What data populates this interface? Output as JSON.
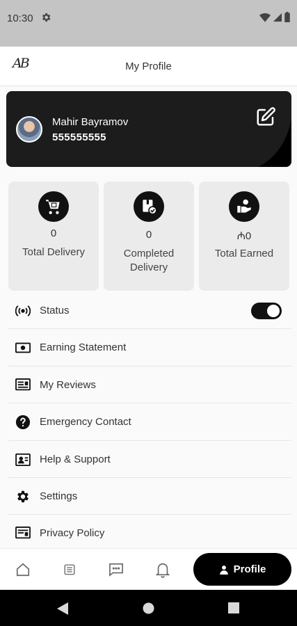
{
  "status_bar": {
    "time": "10:30",
    "icons": [
      "gear-icon",
      "wifi-icon",
      "signal-icon",
      "battery-icon"
    ]
  },
  "app_bar": {
    "logo": "AB",
    "title": "My Profile"
  },
  "profile": {
    "name": "Mahir Bayramov",
    "phone": "555555555",
    "edit_icon": "edit-icon"
  },
  "stats": [
    {
      "icon": "cart-icon",
      "value": "0",
      "label": "Total Delivery"
    },
    {
      "icon": "package-check-icon",
      "value": "0",
      "label": "Completed Delivery"
    },
    {
      "icon": "money-hand-icon",
      "value": "₼0",
      "label": "Total Earned"
    }
  ],
  "menu": [
    {
      "icon": "broadcast-icon",
      "label": "Status",
      "toggle": true
    },
    {
      "icon": "money-icon",
      "label": "Earning Statement"
    },
    {
      "icon": "reviews-icon",
      "label": "My Reviews"
    },
    {
      "icon": "help-circle-icon",
      "label": "Emergency Contact"
    },
    {
      "icon": "contact-card-icon",
      "label": "Help & Support"
    },
    {
      "icon": "settings-icon",
      "label": "Settings"
    },
    {
      "icon": "policy-icon",
      "label": "Privacy Policy"
    }
  ],
  "bottom_nav": {
    "items": [
      "home-icon",
      "list-icon",
      "chat-icon",
      "bell-icon"
    ],
    "active_label": "Profile"
  },
  "colors": {
    "accent": "#000000",
    "card": "#1c1c1c",
    "tile": "#ebebeb",
    "statusbar": "#c4c4c4"
  }
}
